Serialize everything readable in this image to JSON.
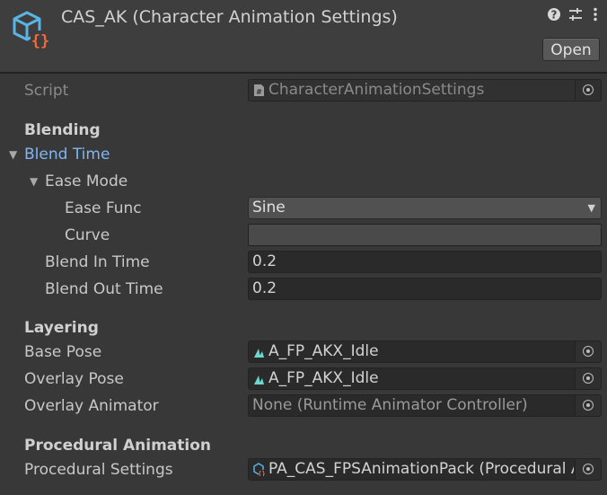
{
  "header": {
    "title": "CAS_AK (Character Animation Settings)",
    "help_icon": "help-icon",
    "preset_icon": "preset-sliders-icon",
    "menu_icon": "kebab-menu-icon",
    "open_label": "Open"
  },
  "script_row": {
    "label": "Script",
    "value": "CharacterAnimationSettings"
  },
  "blending": {
    "section_label": "Blending",
    "blend_time_label": "Blend Time",
    "ease_mode_label": "Ease Mode",
    "ease_func_label": "Ease Func",
    "ease_func_value": "Sine",
    "curve_label": "Curve",
    "blend_in_label": "Blend In Time",
    "blend_in_value": "0.2",
    "blend_out_label": "Blend Out Time",
    "blend_out_value": "0.2"
  },
  "layering": {
    "section_label": "Layering",
    "base_pose_label": "Base Pose",
    "base_pose_value": "A_FP_AKX_Idle",
    "overlay_pose_label": "Overlay Pose",
    "overlay_pose_value": "A_FP_AKX_Idle",
    "overlay_animator_label": "Overlay Animator",
    "overlay_animator_value": "None (Runtime Animator Controller)"
  },
  "procedural": {
    "section_label": "Procedural Animation",
    "settings_label": "Procedural Settings",
    "settings_value": "PA_CAS_FPSAnimationPack (Procedural A"
  },
  "colors": {
    "background": "#383838",
    "header_bg": "#3e3e3e",
    "accent_blue": "#7fb6f2",
    "icon_cyan": "#5ab4e6",
    "icon_orange": "#f26b38"
  }
}
